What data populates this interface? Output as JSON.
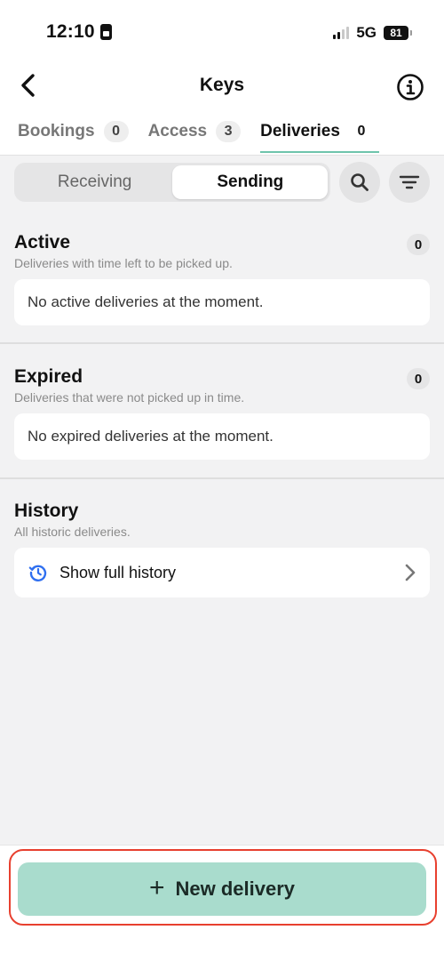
{
  "status_bar": {
    "time": "12:10",
    "network": "5G",
    "battery": "81"
  },
  "header": {
    "title": "Keys"
  },
  "tabs": [
    {
      "label": "Bookings",
      "count": "0",
      "active": false
    },
    {
      "label": "Access",
      "count": "3",
      "active": false
    },
    {
      "label": "Deliveries",
      "count": "0",
      "active": true
    }
  ],
  "segments": {
    "receiving": "Receiving",
    "sending": "Sending",
    "selected": "Sending"
  },
  "sections": {
    "active": {
      "title": "Active",
      "subtitle": "Deliveries with time left to be picked up.",
      "count": "0",
      "empty": "No active deliveries at the moment."
    },
    "expired": {
      "title": "Expired",
      "subtitle": "Deliveries that were not picked up in time.",
      "count": "0",
      "empty": "No expired deliveries at the moment."
    },
    "history": {
      "title": "History",
      "subtitle": "All historic deliveries.",
      "link": "Show full history"
    }
  },
  "cta": {
    "label": "New delivery",
    "plus": "+"
  },
  "colors": {
    "accent": "#6ec4ac",
    "cta_bg": "#a9dccd",
    "highlight": "#e8402f",
    "history_icon": "#2f6ff0"
  }
}
